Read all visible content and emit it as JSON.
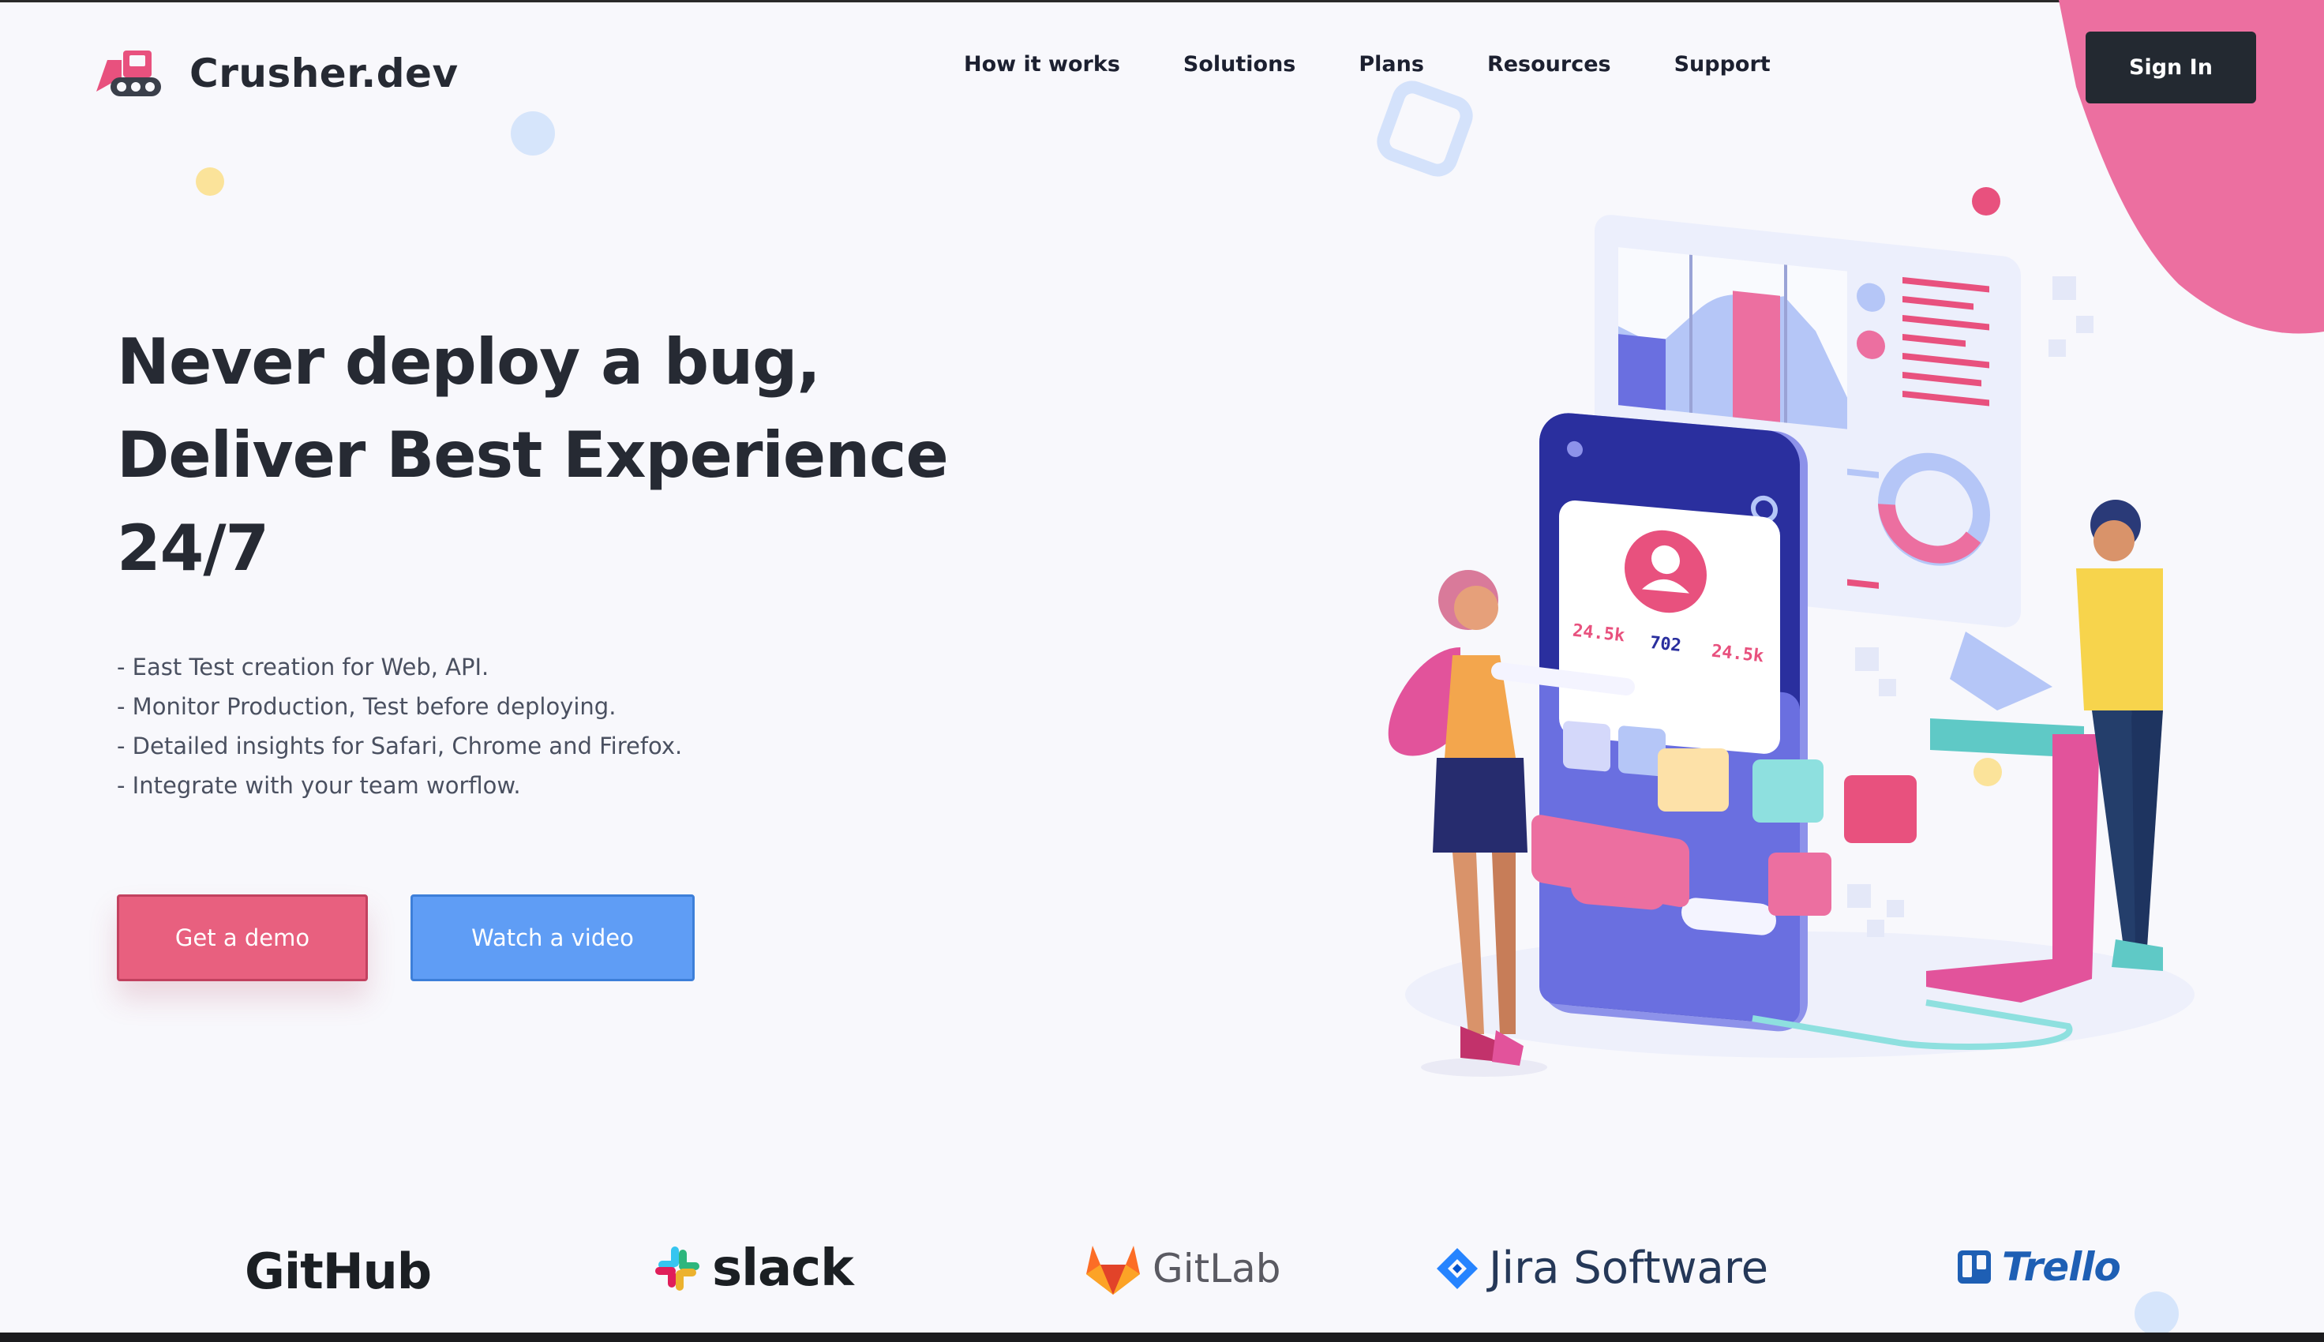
{
  "brand": {
    "name": "Crusher.dev",
    "logo_icon": "bulldozer-icon"
  },
  "nav": {
    "items": [
      {
        "label": "How it works"
      },
      {
        "label": "Solutions"
      },
      {
        "label": "Plans"
      },
      {
        "label": "Resources"
      },
      {
        "label": "Support"
      }
    ],
    "signin_label": "Sign In"
  },
  "hero": {
    "headline_lines": [
      "Never deploy a bug,",
      "Deliver Best Experience",
      "24/7"
    ],
    "features": [
      "- East Test creation for Web, API.",
      "- Monitor Production, Test before deploying.",
      "- Detailed insights for Safari, Chrome and Firefox.",
      "- Integrate with your team worflow."
    ],
    "demo_label": "Get a demo",
    "video_label": "Watch a video"
  },
  "illustration": {
    "stats": [
      "24.5k",
      "702",
      "24.5k"
    ]
  },
  "partners": {
    "github": "GitHub",
    "slack": "slack",
    "gitlab": "GitLab",
    "jira": "Jira Software",
    "trello": "Trello"
  },
  "colors": {
    "accent_pink": "#e8607f",
    "accent_blue": "#5f9df5",
    "dark": "#232931",
    "phone_indigo": "#6a6fe0"
  }
}
